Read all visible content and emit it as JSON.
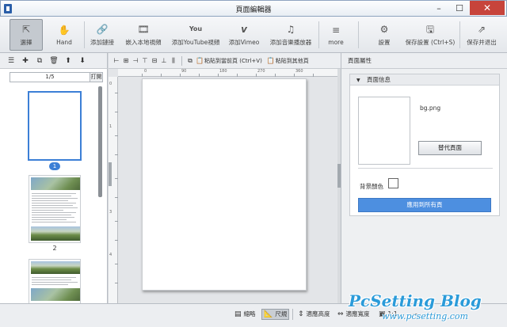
{
  "window": {
    "title": "頁面編輯器",
    "minimize": "–",
    "maximize": "☐",
    "close": "✕"
  },
  "toolbar": {
    "items": [
      {
        "label": "選擇",
        "icon": "⇱"
      },
      {
        "label": "Hand",
        "icon": "✋"
      },
      {
        "label": "添加鏈接",
        "icon": "🔗"
      },
      {
        "label": "嵌入本地視頻",
        "icon": "🎞"
      },
      {
        "label": "添加YouTube視頻",
        "icon": "You"
      },
      {
        "label": "添加Vimeo",
        "icon": "v"
      },
      {
        "label": "添加音樂播放器",
        "icon": "♫"
      },
      {
        "label": "more",
        "icon": "≡"
      },
      {
        "label": "設置",
        "icon": "⚙"
      },
      {
        "label": "保存設置 (Ctrl+S)",
        "icon": "🖫"
      },
      {
        "label": "保存并退出",
        "icon": "⇗"
      }
    ]
  },
  "left_toolbar": {
    "icons": [
      "☰",
      "✚",
      "⧉",
      "🗑",
      "⬆",
      "⬇"
    ]
  },
  "center_toolbar": {
    "paste_current": "粘貼到當前頁 (Ctrl+V)",
    "paste_other": "粘貼到其他頁"
  },
  "right_panel": {
    "tab_title": "頁面屬性",
    "section_title": "頁面信息",
    "bg_name": "bg.png",
    "replace_button": "替代頁面",
    "bgcolor_label": "背景顏色",
    "apply_button": "應用到所有頁"
  },
  "pages": {
    "current": "1/5",
    "go_label": "打開",
    "labels": [
      "1",
      "2"
    ]
  },
  "ruler": {
    "top": [
      "0",
      "90",
      "180",
      "270",
      "360"
    ],
    "left": [
      "0",
      "1",
      "2",
      "3",
      "4"
    ]
  },
  "statusbar": {
    "thumb_label": "縮略",
    "scale_label": "尺規",
    "fit_height": "適應高度",
    "fit_width": "適應寬度",
    "ratio": "1:1",
    "zoom": "－"
  },
  "watermark": {
    "main": "PcSetting Blog",
    "sub": "www.pcsetting.com"
  }
}
